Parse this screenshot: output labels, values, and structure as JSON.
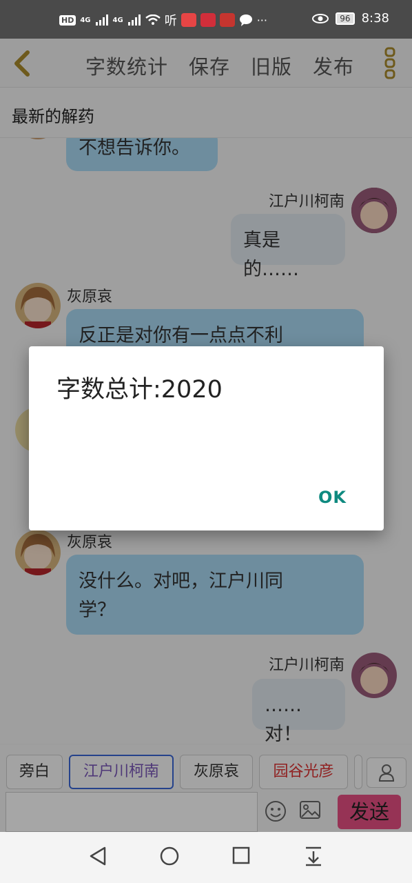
{
  "status_bar": {
    "left_tags": [
      "HD",
      "4G",
      "4G"
    ],
    "listen_glyph": "听",
    "battery": "96",
    "time": "8:38",
    "icons": [
      "signal-icon",
      "wifi-icon",
      "eye-icon",
      "battery-icon"
    ]
  },
  "topbar": {
    "actions": [
      "字数统计",
      "保存",
      "旧版",
      "发布"
    ]
  },
  "story_title": "最新的解药",
  "messages": [
    {
      "speaker": "",
      "text": "不想告诉你。",
      "side": "left"
    },
    {
      "speaker": "江户川柯南",
      "text": "真是的……",
      "side": "right"
    },
    {
      "speaker": "灰原哀",
      "text": "反正是对你有一点点不利",
      "side": "left"
    },
    {
      "speaker": "灰原哀",
      "text": "没什么。对吧，江户川同学？",
      "line1": "没什么。对吧，江户川同",
      "line2": "学？",
      "side": "left"
    },
    {
      "speaker": "江户川柯南",
      "text": "……对！",
      "side": "right"
    }
  ],
  "characters": [
    "旁白",
    "江户川柯南",
    "灰原哀",
    "园谷光彦"
  ],
  "input": {
    "placeholder": "",
    "send_label": "发送"
  },
  "dialog": {
    "message": "字数总计:2020",
    "ok_label": "OK"
  },
  "colors": {
    "accent_blue": "#3a66d6",
    "send_pink": "#e74f83",
    "ok_teal": "#0f8a80"
  }
}
